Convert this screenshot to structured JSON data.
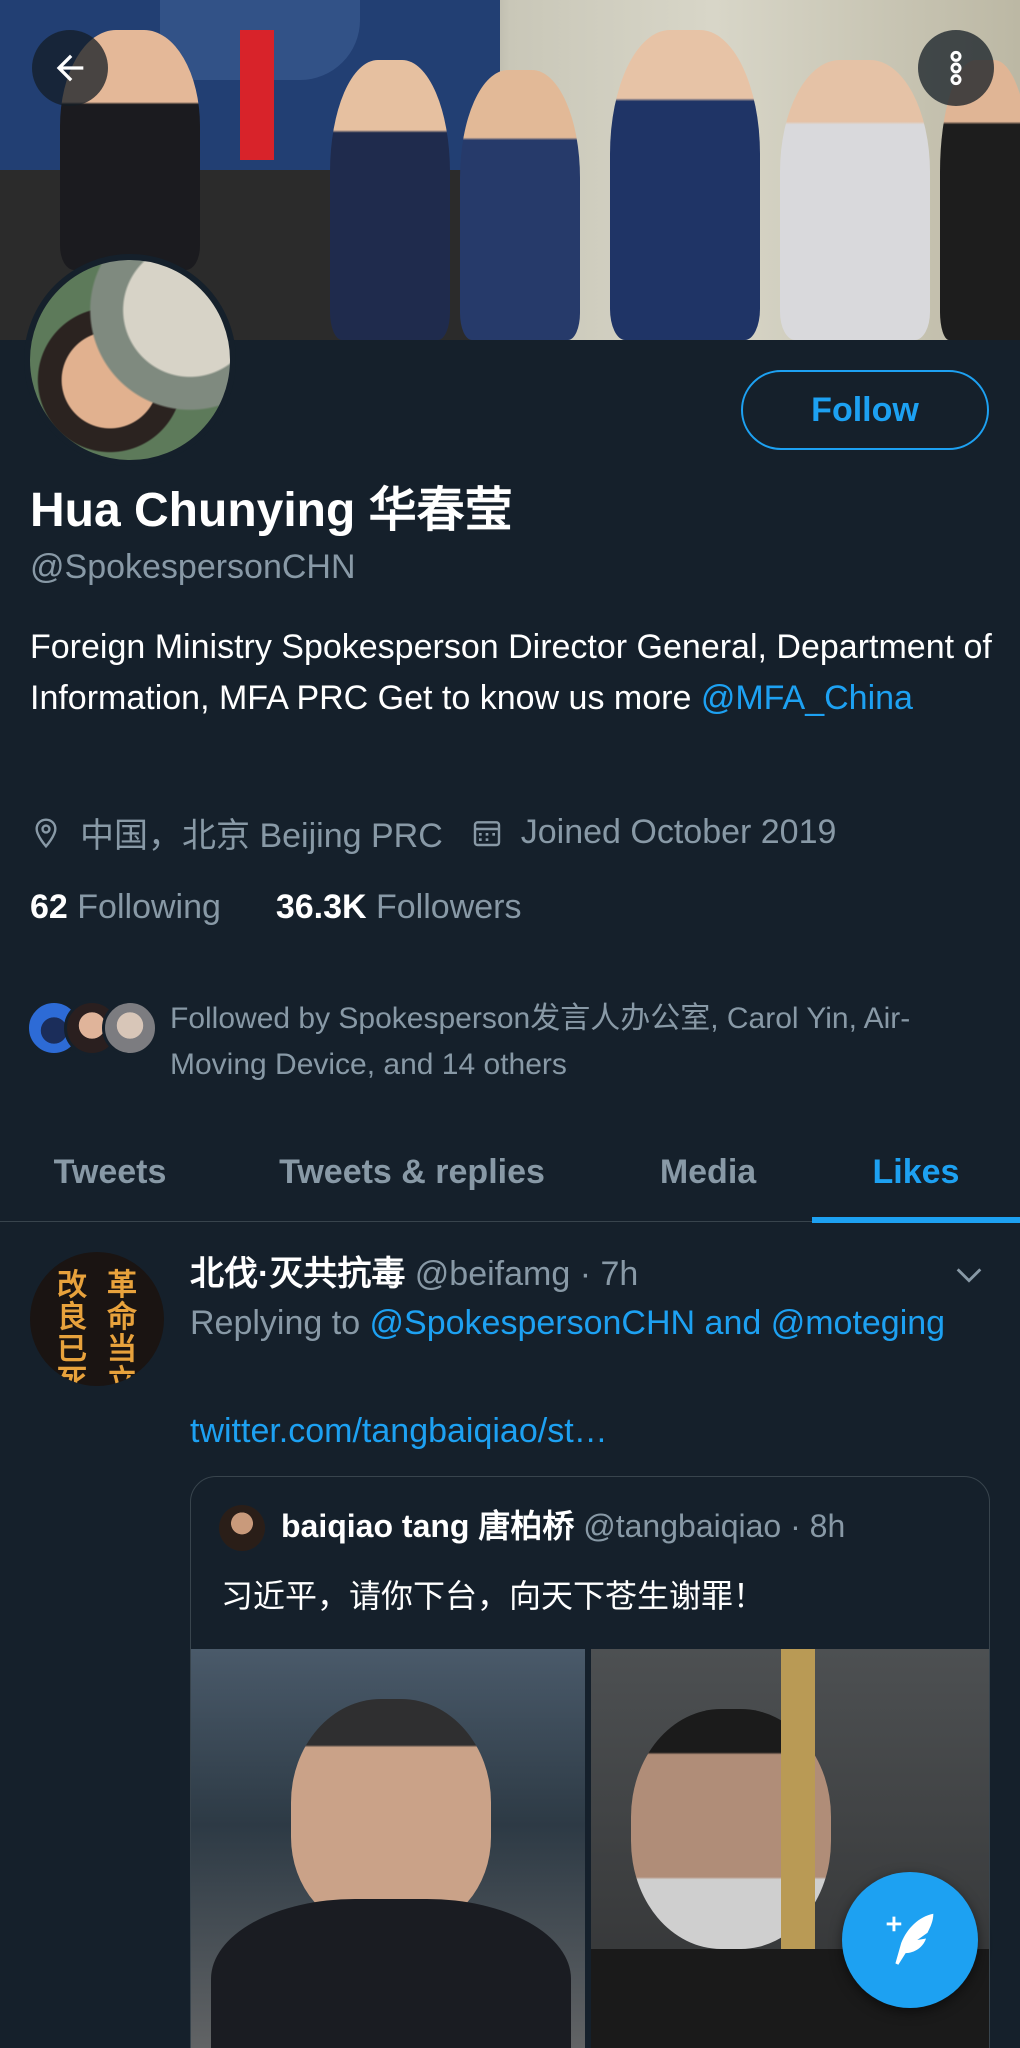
{
  "header": {
    "back_icon": "arrow-left-icon",
    "more_icon": "more-vertical-icon"
  },
  "profile": {
    "follow_label": "Follow",
    "name": "Hua Chunying 华春莹",
    "handle": "@SpokespersonCHN",
    "bio_text": "Foreign Ministry Spokesperson Director General, Department of Information, MFA PRC Get to know us more ",
    "bio_link": "@MFA_China",
    "location": "中国，北京 Beijing PRC",
    "joined": "Joined October 2019",
    "following_count": "62",
    "following_label": "Following",
    "followers_count": "36.3K",
    "followers_label": "Followers",
    "followed_by": "Followed by Spokesperson发言人办公室, Carol Yin, Air-Moving Device, and 14 others"
  },
  "tabs": [
    {
      "label": "Tweets",
      "active": false
    },
    {
      "label": "Tweets & replies",
      "active": false
    },
    {
      "label": "Media",
      "active": false
    },
    {
      "label": "Likes",
      "active": true
    }
  ],
  "tweet": {
    "display_name": "北伐·灭共抗毒",
    "username": "@beifamg",
    "time": "· 7h",
    "replying_prefix": "Replying to ",
    "replying_to": "@SpokespersonCHN and @moteging",
    "link": "twitter.com/tangbaiqiao/st…",
    "avatar_text_right": "革命当立",
    "avatar_text_left": "改良已死",
    "quote": {
      "display_name": "baiqiao tang 唐柏桥",
      "username": "@tangbaiqiao",
      "time": "· 8h",
      "text": "习近平，请你下台，向天下苍生谢罪！"
    }
  },
  "fab": {
    "icon": "compose-tweet-icon",
    "label": "+"
  },
  "colors": {
    "background": "#15202b",
    "accent": "#1da1f2",
    "secondary_text": "#8899a6",
    "divider": "#38444d"
  }
}
